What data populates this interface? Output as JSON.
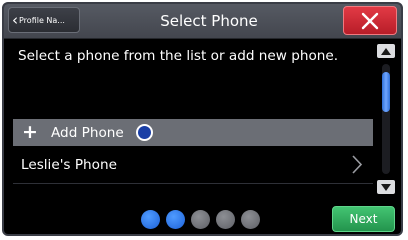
{
  "header": {
    "back_label": "Profile Na...",
    "title": "Select Phone",
    "close_icon": "close-icon"
  },
  "instruction": "Select a phone from the list or add new phone.",
  "list": {
    "add_phone_label": "Add Phone",
    "add_icon": "plus-icon",
    "items": [
      {
        "label": "Leslie's Phone",
        "icon": "chevron-right-icon"
      }
    ]
  },
  "scrollbar": {
    "up_icon": "triangle-up-icon",
    "down_icon": "triangle-down-icon"
  },
  "pager": {
    "total_pages": 5,
    "active_pages": 2
  },
  "footer": {
    "next_label": "Next"
  },
  "colors": {
    "background": "#000000",
    "header": "#4c4f57",
    "close": "#d22a35",
    "selected_row": "#6b6e75",
    "accent_blue": "#1d62d8",
    "next": "#2fb05e"
  }
}
